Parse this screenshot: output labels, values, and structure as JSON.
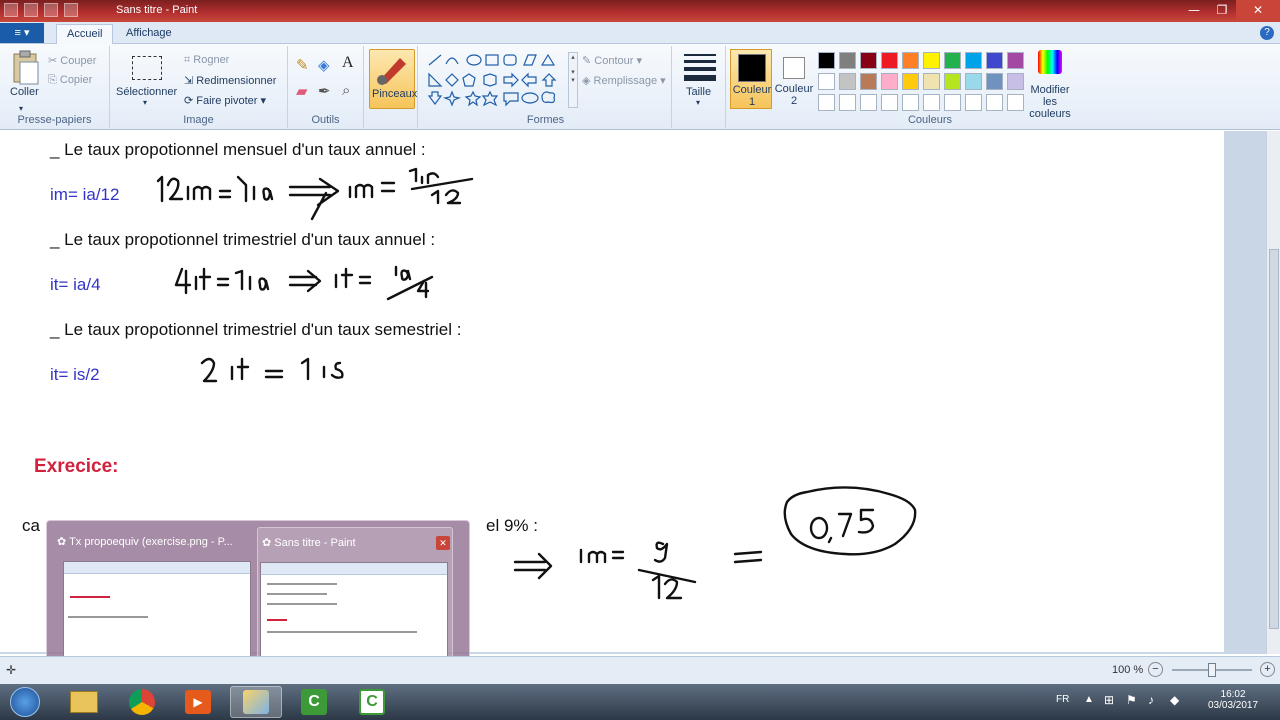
{
  "window": {
    "title": "Sans titre - Paint",
    "min": "—",
    "max": "❐",
    "close": "✕"
  },
  "tabs": {
    "file": "≡ ▾",
    "home": "Accueil",
    "view": "Affichage",
    "help": "?"
  },
  "ribbon": {
    "clipboard": {
      "paste": "Coller",
      "cut": "Couper",
      "copy": "Copier",
      "label": "Presse-papiers"
    },
    "image": {
      "select": "Sélectionner",
      "crop": "Rogner",
      "resize": "Redimensionner",
      "rotate": "Faire pivoter ▾",
      "label": "Image"
    },
    "tools": {
      "label": "Outils"
    },
    "brushes": {
      "label": "Pinceaux"
    },
    "shapes": {
      "outline": "Contour ▾",
      "fill": "Remplissage ▾",
      "label": "Formes"
    },
    "size": {
      "label": "Taille"
    },
    "colors": {
      "color1": "Couleur 1",
      "color2": "Couleur 2",
      "edit": "Modifier les couleurs",
      "label": "Couleurs",
      "palette_row1": [
        "#000000",
        "#7f7f7f",
        "#880015",
        "#ed1c24",
        "#ff7f27",
        "#fff200",
        "#22b14c",
        "#00a2e8",
        "#3f48cc",
        "#a349a4"
      ],
      "palette_row2": [
        "#ffffff",
        "#c3c3c3",
        "#b97a57",
        "#ffaec9",
        "#ffc90e",
        "#efe4b0",
        "#b5e61d",
        "#99d9ea",
        "#7092be",
        "#c8bfe7"
      ]
    }
  },
  "document": {
    "line1": "_ Le taux propotionnel mensuel d'un taux annuel :",
    "formula1": "im= ia/12",
    "line2": "_ Le taux propotionnel trimestriel d'un taux annuel :",
    "formula2": "it= ia/4",
    "line3": "_ Le taux propotionnel trimestriel d'un taux semestriel :",
    "formula3": "it=  is/2",
    "exercise": "Exrecice:",
    "exercise_left": "ca",
    "exercise_right": "el 9% :"
  },
  "handwriting": {
    "h1": "12im = 1ia ⇒ im = 1ia/12",
    "h2": "4it = 1ia ⇒ it = ia/4",
    "h3": "2 it = 1 is",
    "h4": "⇒ im = 9/12 = 0,75"
  },
  "preview": {
    "win1": "Tx propoequiv (exercise.png - P...",
    "win2": "Sans titre - Paint",
    "close": "✕"
  },
  "status": {
    "zoom": "100 %",
    "minus": "−",
    "plus": "+"
  },
  "taskbar": {
    "lang": "FR",
    "time": "16:02",
    "date": "03/03/2017"
  }
}
